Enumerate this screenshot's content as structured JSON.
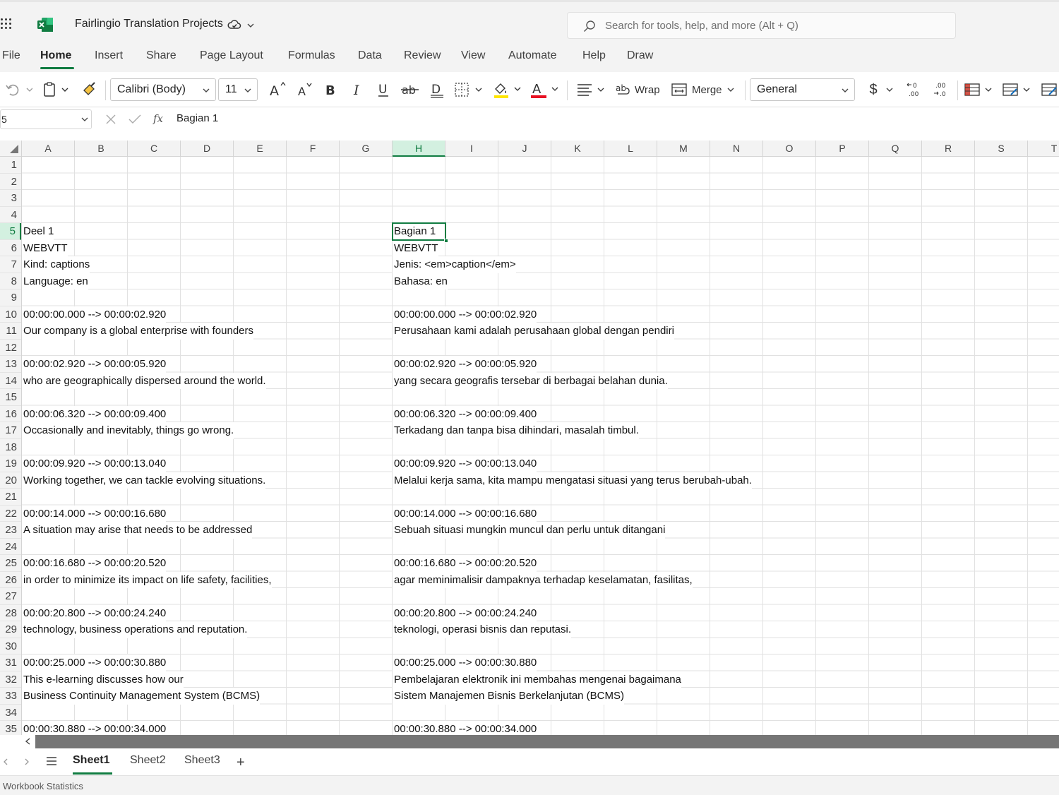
{
  "app": {
    "title": "Fairlingio Translation Projects",
    "brand_color": "#107c41",
    "search_placeholder": "Search for tools, help, and more (Alt + Q)"
  },
  "menu": {
    "items": [
      "File",
      "Home",
      "Insert",
      "Share",
      "Page Layout",
      "Formulas",
      "Data",
      "Review",
      "View",
      "Automate",
      "Help",
      "Draw"
    ],
    "active": "Home"
  },
  "ribbon": {
    "font_name": "Calibri (Body)",
    "font_size": "11",
    "wrap_label": "Wrap",
    "merge_label": "Merge",
    "number_format": "General",
    "currency_symbol": "$",
    "icons": [
      "undo-icon",
      "paste-icon",
      "format-painter-icon",
      "increase-font-icon",
      "decrease-font-icon",
      "bold-icon",
      "italic-icon",
      "underline-icon",
      "strikethrough-icon",
      "double-underline-icon",
      "borders-icon",
      "fill-color-icon",
      "font-color-icon",
      "align-icon",
      "wrap-icon",
      "merge-icon",
      "currency-icon",
      "increase-decimal-icon",
      "decrease-decimal-icon",
      "conditional-format-icon",
      "format-as-table-icon",
      "cell-styles-icon"
    ]
  },
  "formula_bar": {
    "name_box": "5",
    "fx": "fx",
    "value": "Bagian 1"
  },
  "grid": {
    "columns": [
      "A",
      "B",
      "C",
      "D",
      "E",
      "F",
      "G",
      "H",
      "I",
      "J",
      "K",
      "L",
      "M",
      "N",
      "O",
      "P",
      "Q",
      "R",
      "S",
      "T"
    ],
    "selected_column": "H",
    "selected_row": "5",
    "rows": [
      {
        "n": "1",
        "a": "",
        "h": ""
      },
      {
        "n": "2",
        "a": "",
        "h": ""
      },
      {
        "n": "3",
        "a": "",
        "h": ""
      },
      {
        "n": "4",
        "a": "",
        "h": ""
      },
      {
        "n": "5",
        "a": "Deel 1",
        "h": "Bagian 1"
      },
      {
        "n": "6",
        "a": "WEBVTT",
        "h": "WEBVTT"
      },
      {
        "n": "7",
        "a": "Kind: captions",
        "h": "Jenis: <em>caption</em>"
      },
      {
        "n": "8",
        "a": "Language: en",
        "h": "Bahasa: en"
      },
      {
        "n": "9",
        "a": "",
        "h": ""
      },
      {
        "n": "10",
        "a": "00:00:00.000 --> 00:00:02.920",
        "h": "00:00:00.000 --> 00:00:02.920"
      },
      {
        "n": "11",
        "a": "Our company is a global enterprise with founders",
        "h": "Perusahaan kami adalah perusahaan global dengan pendiri"
      },
      {
        "n": "12",
        "a": "",
        "h": ""
      },
      {
        "n": "13",
        "a": "00:00:02.920 --> 00:00:05.920",
        "h": "00:00:02.920 --> 00:00:05.920"
      },
      {
        "n": "14",
        "a": "who are geographically dispersed around the world.",
        "h": "yang secara geografis tersebar di berbagai belahan dunia."
      },
      {
        "n": "15",
        "a": "",
        "h": ""
      },
      {
        "n": "16",
        "a": "00:00:06.320 --> 00:00:09.400",
        "h": "00:00:06.320 --> 00:00:09.400"
      },
      {
        "n": "17",
        "a": "Occasionally and inevitably, things go wrong.",
        "h": "Terkadang dan tanpa bisa dihindari, masalah timbul."
      },
      {
        "n": "18",
        "a": "",
        "h": ""
      },
      {
        "n": "19",
        "a": "00:00:09.920 --> 00:00:13.040",
        "h": "00:00:09.920 --> 00:00:13.040"
      },
      {
        "n": "20",
        "a": "Working together, we can tackle evolving situations.",
        "h": "Melalui kerja sama, kita mampu mengatasi situasi yang terus berubah-ubah."
      },
      {
        "n": "21",
        "a": "",
        "h": ""
      },
      {
        "n": "22",
        "a": "00:00:14.000 --> 00:00:16.680",
        "h": "00:00:14.000 --> 00:00:16.680"
      },
      {
        "n": "23",
        "a": "A situation may arise that needs to be addressed",
        "h": "Sebuah situasi mungkin muncul dan perlu untuk ditangani"
      },
      {
        "n": "24",
        "a": "",
        "h": ""
      },
      {
        "n": "25",
        "a": "00:00:16.680 --> 00:00:20.520",
        "h": "00:00:16.680 --> 00:00:20.520"
      },
      {
        "n": "26",
        "a": "in order to minimize its impact on life safety, facilities,",
        "h": "agar meminimalisir dampaknya terhadap keselamatan, fasilitas,"
      },
      {
        "n": "27",
        "a": "",
        "h": ""
      },
      {
        "n": "28",
        "a": "00:00:20.800 --> 00:00:24.240",
        "h": "00:00:20.800 --> 00:00:24.240"
      },
      {
        "n": "29",
        "a": "technology, business operations and reputation.",
        "h": "teknologi, operasi bisnis dan reputasi."
      },
      {
        "n": "30",
        "a": "",
        "h": ""
      },
      {
        "n": "31",
        "a": "00:00:25.000 --> 00:00:30.880",
        "h": "00:00:25.000 --> 00:00:30.880"
      },
      {
        "n": "32",
        "a": "This e-learning discusses how our",
        "h": "Pembelajaran elektronik ini membahas mengenai bagaimana"
      },
      {
        "n": "33",
        "a": "Business Continuity Management System (BCMS)",
        "h": "Sistem Manajemen Bisnis Berkelanjutan (BCMS)"
      },
      {
        "n": "34",
        "a": "",
        "h": ""
      },
      {
        "n": "35",
        "a": "00:00:30.880 --> 00:00:34.000",
        "h": "00:00:30.880 --> 00:00:34.000"
      }
    ]
  },
  "sheets": {
    "tabs": [
      "Sheet1",
      "Sheet2",
      "Sheet3"
    ],
    "active": "Sheet1",
    "add": "+"
  },
  "status": {
    "text": "Workbook Statistics"
  }
}
